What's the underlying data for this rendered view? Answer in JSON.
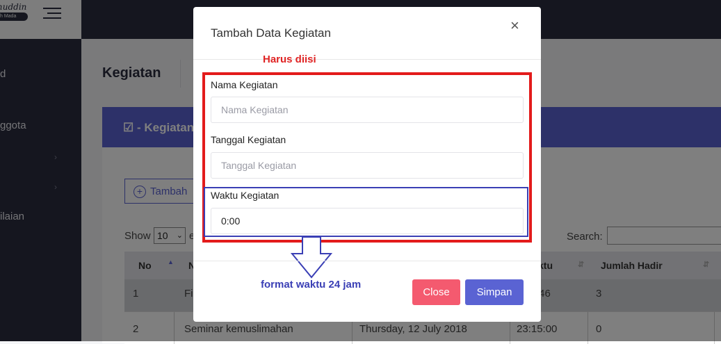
{
  "brand": {
    "line1": "huddin",
    "line2": "h Mada"
  },
  "sidebar": {
    "items": [
      "d",
      "ggota",
      "",
      "",
      "ilaian"
    ]
  },
  "page": {
    "title": "Kegiatan"
  },
  "card": {
    "header": "- Kegiatan",
    "add_button": "Tambah"
  },
  "table": {
    "show_label": "Show",
    "show_value": "10",
    "entries_label": "e",
    "search_label": "Search:",
    "headers": [
      "No",
      "N",
      "ktu",
      "Jumlah Hadir"
    ],
    "rows": [
      [
        "1",
        "Fi",
        "",
        ":46",
        "3"
      ],
      [
        "2",
        "Seminar kemuslimahan",
        "Thursday, 12 July 2018",
        "23:15:00",
        "0"
      ]
    ]
  },
  "modal": {
    "title": "Tambah Data Kegiatan",
    "close_icon": "×",
    "required_note": "Harus diisi",
    "fields": [
      {
        "label": "Nama Kegiatan",
        "placeholder": "Nama Kegiatan",
        "value": ""
      },
      {
        "label": "Tanggal Kegiatan",
        "placeholder": "Tanggal Kegiatan",
        "value": ""
      },
      {
        "label": "Waktu Kegiatan",
        "placeholder": "",
        "value": "0:00"
      }
    ],
    "format_note": "format waktu 24 jam",
    "close_button": "Close",
    "save_button": "Simpan"
  },
  "colors": {
    "primary": "#5a63d3",
    "danger": "#f45a6f",
    "sidebar": "#2b2d3e",
    "annotation_red": "#e31b1b",
    "annotation_blue": "#3a3fb5"
  }
}
